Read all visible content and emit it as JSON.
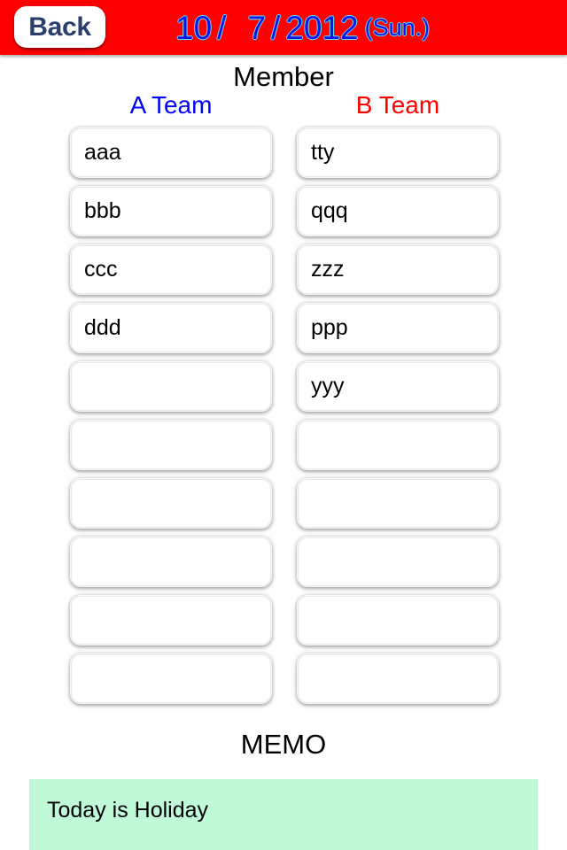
{
  "navbar": {
    "back_label": "Back",
    "date": {
      "month": "10",
      "day": "7",
      "year": "2012",
      "weekday": "(Sun.)",
      "separator": "/"
    },
    "bar_color": "#fe0000",
    "date_color": "#1111e6"
  },
  "member": {
    "section_title": "Member",
    "team_a": {
      "title": "A Team",
      "color": "#0000ff",
      "members": [
        "aaa",
        "bbb",
        "ccc",
        "ddd",
        "",
        "",
        "",
        "",
        "",
        ""
      ]
    },
    "team_b": {
      "title": "B Team",
      "color": "#fe0000",
      "members": [
        "tty",
        "qqq",
        "zzz",
        "ppp",
        "yyy",
        "",
        "",
        "",
        "",
        ""
      ]
    }
  },
  "memo": {
    "title": "MEMO",
    "text": "Today is Holiday",
    "background_color": "#bff9d8"
  }
}
